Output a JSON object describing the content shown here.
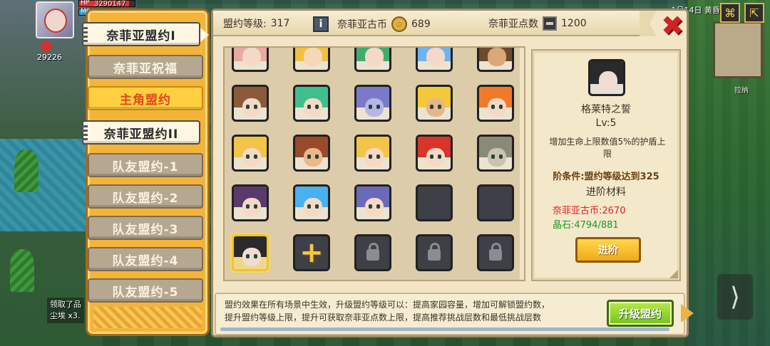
{
  "hud": {
    "hp_label": "HP",
    "hp_value": "3290147",
    "mp_label": "MP",
    "power_value": "29226",
    "clock_text": "1月14日 黄昏",
    "map_label": "拉纳",
    "log_line1": "领取了品",
    "log_line2": "尘埃 x3."
  },
  "tabs": [
    {
      "label": "奈菲亚盟约I",
      "style": "main",
      "active": true
    },
    {
      "label": "奈菲亚祝福",
      "style": "normal",
      "active": false
    },
    {
      "label": "主角盟约",
      "style": "highlight",
      "active": false
    },
    {
      "label": "奈菲亚盟约II",
      "style": "main",
      "active": false
    },
    {
      "label": "队友盟约-1",
      "style": "normal",
      "active": false
    },
    {
      "label": "队友盟约-2",
      "style": "normal",
      "active": false
    },
    {
      "label": "队友盟约-3",
      "style": "normal",
      "active": false
    },
    {
      "label": "队友盟约-4",
      "style": "normal",
      "active": false
    },
    {
      "label": "队友盟约-5",
      "style": "normal",
      "active": false
    }
  ],
  "topbar": {
    "level_label": "盟约等级:",
    "level_value": "317",
    "coin_label": "奈菲亚古币",
    "coin_value": "689",
    "points_label": "奈菲亚点数",
    "points_value": "1200"
  },
  "grid": {
    "partial_row": [
      {
        "hair": "#e9a9a0",
        "skin": "#f5d8c6"
      },
      {
        "hair": "#f1c040",
        "skin": "#f6d7b8"
      },
      {
        "hair": "#3fae6d",
        "skin": "#f5d8c6"
      },
      {
        "hair": "#6cb4f0",
        "skin": "#f5d8c6"
      },
      {
        "hair": "#6c4a2a",
        "skin": "#d9a878"
      }
    ],
    "rows": [
      [
        {
          "type": "hero",
          "hair": "#8a5a3a",
          "skin": "#f5d8c6"
        },
        {
          "type": "hero",
          "hair": "#3fbf8d",
          "skin": "#f5d8c6"
        },
        {
          "type": "hero",
          "hair": "#7a7ac8",
          "skin": "#b5b5e6"
        },
        {
          "type": "hero",
          "hair": "#f3c83a",
          "skin": "#e6b58a"
        },
        {
          "type": "hero",
          "hair": "#f07a2a",
          "skin": "#f5d8c6"
        }
      ],
      [
        {
          "type": "hero",
          "hair": "#f2c448",
          "skin": "#f5d8c6"
        },
        {
          "type": "hero",
          "hair": "#9a4a2a",
          "skin": "#e9b98a"
        },
        {
          "type": "hero",
          "hair": "#f2c448",
          "skin": "#f5d8c6"
        },
        {
          "type": "hero",
          "hair": "#d8342a",
          "skin": "#f5d8c6"
        },
        {
          "type": "hero",
          "hair": "#8a8a7a",
          "skin": "#c9c4b0"
        }
      ],
      [
        {
          "type": "hero",
          "hair": "#5a3a6a",
          "skin": "#f5d8c6"
        },
        {
          "type": "hero",
          "hair": "#4ab0f0",
          "skin": "#f5d8c6"
        },
        {
          "type": "hero",
          "hair": "#6a6ab8",
          "skin": "#f5d8c6"
        },
        {
          "type": "empty"
        },
        {
          "type": "empty"
        }
      ],
      [
        {
          "type": "selected",
          "hair": "#2a2a2c",
          "skin": "#efdcd3"
        },
        {
          "type": "add"
        },
        {
          "type": "locked"
        },
        {
          "type": "locked"
        },
        {
          "type": "locked"
        }
      ]
    ]
  },
  "detail": {
    "name": "格莱特之誓",
    "level": "Lv:5",
    "description": "增加生命上限数值5%的护盾上限",
    "condition": "阶条件:盟约等级达到325",
    "materials_title": "进阶材料",
    "coin_cost": "奈菲亚古币:2670",
    "gem_cost": "晶石:4794/881",
    "advance_label": "进阶"
  },
  "footer": {
    "description_line1": "盟约效果在所有场景中生效，升级盟约等级可以：提高家园容量，增加可解锁盟约数，",
    "description_line2": "提升盟约等级上限，提升可获取奈菲亚点数上限，提高推荐挑战层数和最低挑战层数",
    "upgrade_label": "升级盟约"
  },
  "colors": {
    "tab_panel": "#f4b43a",
    "dialog_bg": "#f3e6c6",
    "close": "#d02323",
    "coin_cost": "#dd2222",
    "gem_cost": "#1c9a2a",
    "upgrade_button": "#76c21e",
    "advance_button": "#f0a91a"
  },
  "icons": {
    "info": "info-icon",
    "coin": "coin-icon",
    "points": "chip-icon",
    "close": "close-icon",
    "lock": "lock-icon",
    "add": "plus-icon"
  }
}
